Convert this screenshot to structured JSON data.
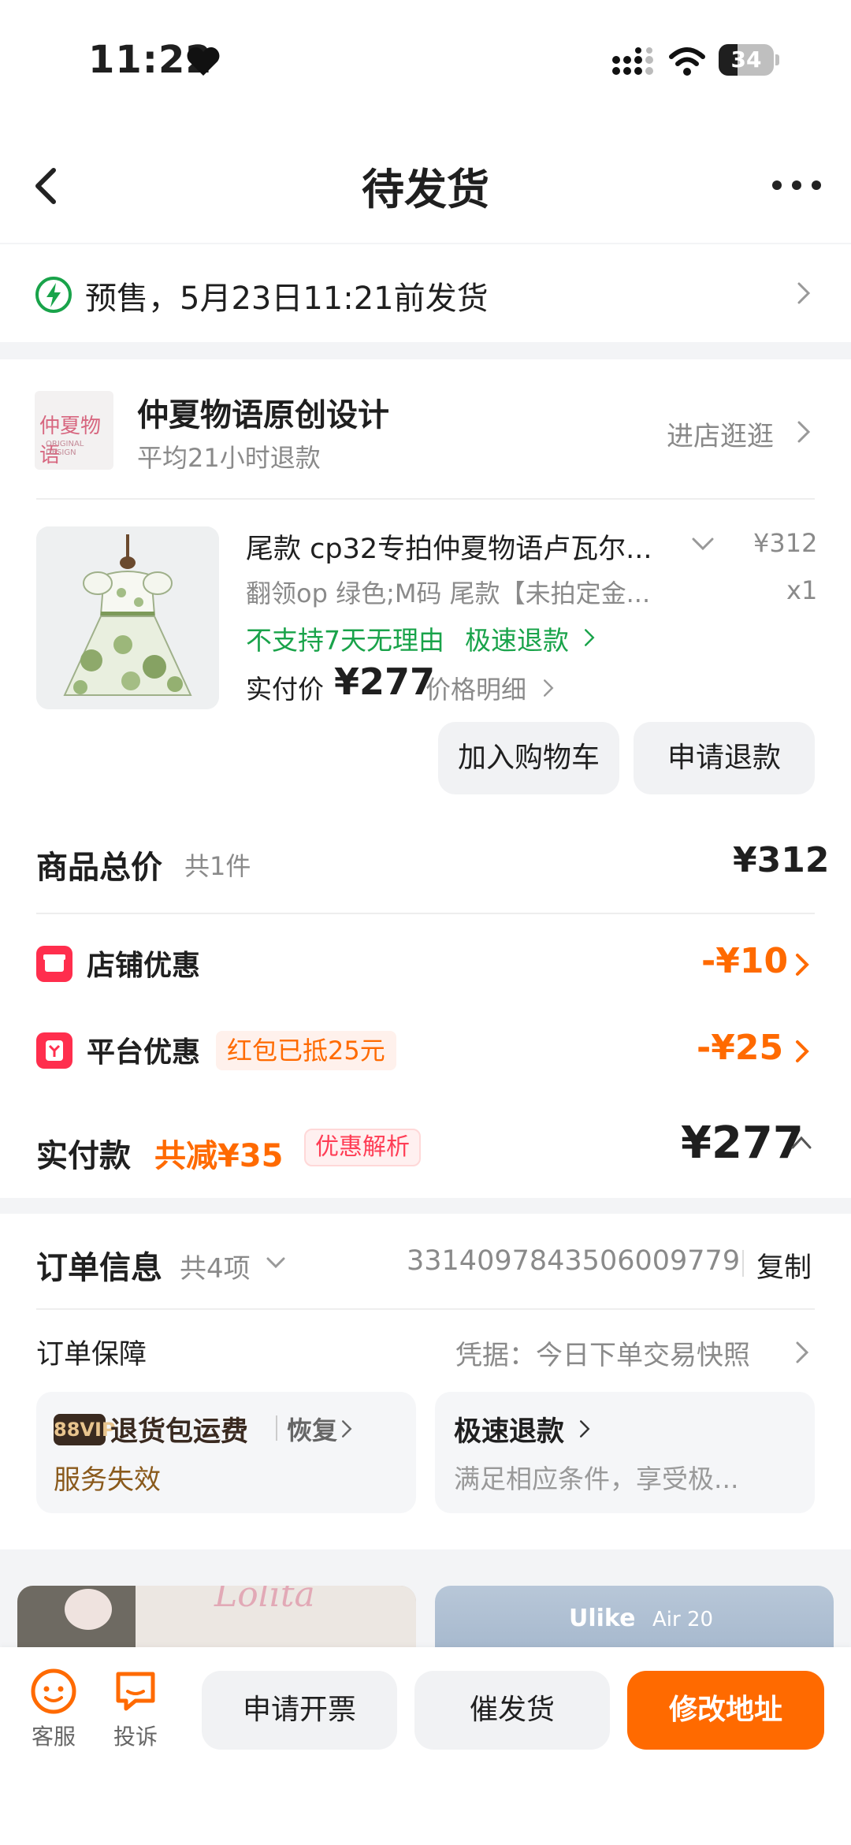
{
  "status_bar": {
    "time": "11:22",
    "battery": "34"
  },
  "header": {
    "title": "待发货"
  },
  "banner": {
    "text": "预售，5月23日11:21前发货"
  },
  "shop": {
    "logo_text": "仲夏物语",
    "logo_sub": "ORIGINAL DESIGN",
    "name": "仲夏物语原创设计",
    "subtitle": "平均21小时退款",
    "visit_label": "进店逛逛"
  },
  "product": {
    "name": "尾款 cp32专拍仲夏物语卢瓦尔...",
    "price": "¥312",
    "spec": "翻领op 绿色;M码 尾款【未拍定金...",
    "qty": "x1",
    "no_return": "不支持7天无理由",
    "fast_refund": "极速退款",
    "real_price_label": "实付价",
    "real_price": "¥277",
    "price_detail": "价格明细",
    "add_cart": "加入购物车",
    "apply_refund": "申请退款"
  },
  "summary": {
    "total_label": "商品总价",
    "total_count": "共1件",
    "total_value": "¥312",
    "shop_discount_label": "店铺优惠",
    "shop_discount_value": "-¥10",
    "platform_discount_label": "平台优惠",
    "platform_tag": "红包已抵25元",
    "platform_discount_value": "-¥25",
    "paid_label": "实付款",
    "saved": "共减¥35",
    "analysis": "优惠解析",
    "paid_value": "¥277"
  },
  "order_info": {
    "title": "订单信息",
    "count": "共4项",
    "order_no": "3314097843506009779",
    "copy": "复制",
    "guarantee": "订单保障",
    "evidence": "凭据：今日下单交易快照",
    "vip": "88VIP",
    "return_shipping": "退货包运费",
    "restore": "恢复",
    "service_failed": "服务失效",
    "fast_refund": "极速退款",
    "fast_refund_desc": "满足相应条件，享受极..."
  },
  "rec": {
    "brand": "Ulike",
    "model": "Air 20"
  },
  "bottom": {
    "service": "客服",
    "complaint": "投诉",
    "invoice": "申请开票",
    "urge": "催发货",
    "modify_address": "修改地址"
  },
  "colors": {
    "accent": "#ff6a00",
    "green": "#19a34a",
    "red": "#ff2e4d",
    "brown": "#8a5a1c"
  }
}
